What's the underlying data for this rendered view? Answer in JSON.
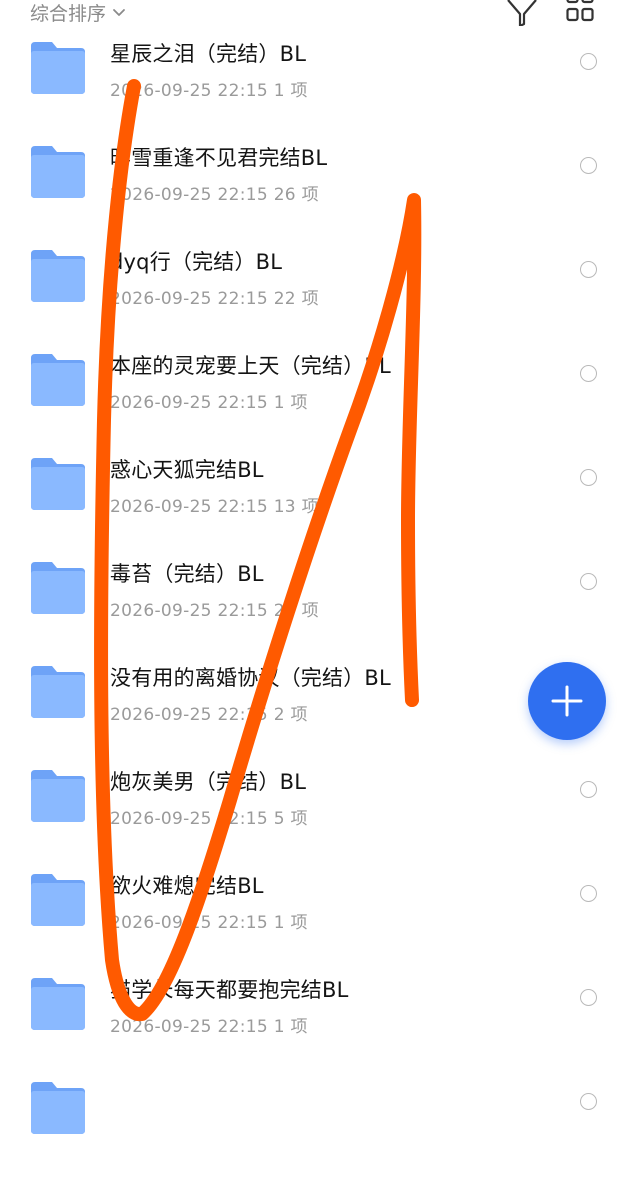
{
  "toolbar": {
    "sort_label": "综合排序",
    "sort_icon": "chevron-down-icon",
    "filter_icon": "filter-icon",
    "view_icon": "grid-view-icon"
  },
  "colors": {
    "folder": "#7fb0ff",
    "accent": "#2f6ff0",
    "scribble": "#ff5a00"
  },
  "files": [
    {
      "title": "星辰之泪（完结）BL",
      "meta": "2026-09-25 22:15 1 项"
    },
    {
      "title": "昨雪重逢不见君完结BL",
      "meta": "2026-09-25 22:15 26 项"
    },
    {
      "title": "dyq行（完结）BL",
      "meta": "2026-09-25 22:15 22 项"
    },
    {
      "title": "本座的灵宠要上天（完结）BL",
      "meta": "2026-09-25 22:15 1 项"
    },
    {
      "title": "惑心天狐完结BL",
      "meta": "2026-09-25 22:15 13 项"
    },
    {
      "title": "毒苔（完结）BL",
      "meta": "2026-09-25 22:15 28 项"
    },
    {
      "title": "没有用的离婚协议（完结）BL",
      "meta": "2026-09-25 22:15 2 项"
    },
    {
      "title": "炮灰美男（完结）BL",
      "meta": "2026-09-25 22:15 5 项"
    },
    {
      "title": "欲火难熄完结BL",
      "meta": "2026-09-25 22:15 1 项"
    },
    {
      "title": "猫学长每天都要抱完结BL",
      "meta": "2026-09-25 22:15 1 项"
    },
    {
      "title": "",
      "meta": ""
    }
  ],
  "fab_icon": "plus-icon"
}
